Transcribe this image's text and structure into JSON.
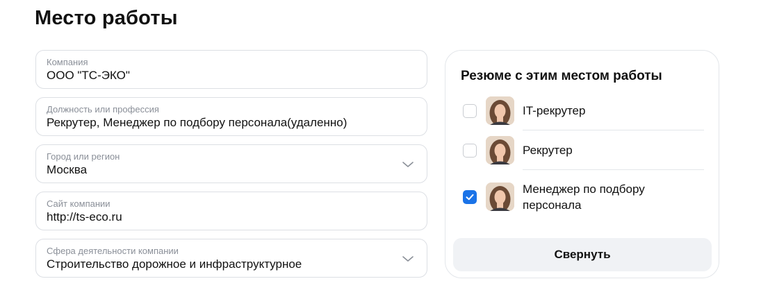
{
  "page_title": "Место работы",
  "fields": {
    "company": {
      "label": "Компания",
      "value": "ООО \"ТС-ЭКО\""
    },
    "position": {
      "label": "Должность или профессия",
      "value": "Рекрутер, Менеджер по подбору персонала(удаленно)"
    },
    "city": {
      "label": "Город или регион",
      "value": "Москва"
    },
    "website": {
      "label": "Сайт компании",
      "value": "http://ts-eco.ru"
    },
    "industry": {
      "label": "Сфера деятельности компании",
      "value": "Строительство дорожное и инфраструктурное"
    }
  },
  "resume_panel": {
    "title": "Резюме с этим местом работы",
    "items": [
      {
        "label": "IT-рекрутер",
        "checked": false
      },
      {
        "label": "Рекрутер",
        "checked": false
      },
      {
        "label_line1": "Менеджер по подбору",
        "label_line2": "персонала",
        "checked": true
      }
    ],
    "collapse_label": "Свернуть"
  },
  "colors": {
    "accent": "#1a73e8",
    "field_border": "#dcdfe4",
    "label_gray": "#8a8f98",
    "button_bg": "#f0f2f5"
  },
  "icons": [
    "chevron-down-icon",
    "check-icon",
    "avatar"
  ]
}
